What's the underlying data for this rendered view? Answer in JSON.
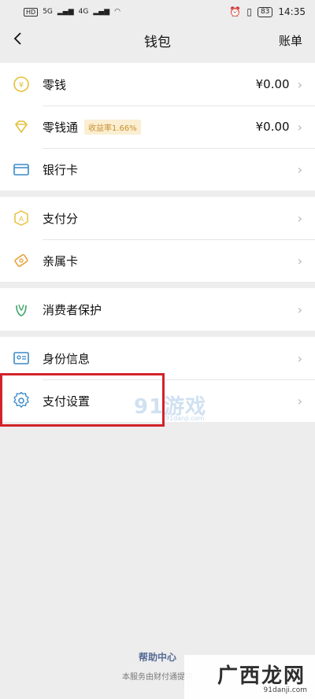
{
  "status": {
    "left_icons": [
      "HD",
      "5G",
      "4G"
    ],
    "battery": "83",
    "time": "14:35"
  },
  "nav": {
    "back_icon": "chevron-left-icon",
    "back_glyph": "<",
    "title": "钱包",
    "right": "账单"
  },
  "groups": [
    {
      "rows": [
        {
          "label": "零钱",
          "value": "¥0.00",
          "icon": "coin-icon",
          "color": "#e6c03a"
        },
        {
          "label": "零钱通",
          "badge": "收益率1.66%",
          "value": "¥0.00",
          "icon": "diamond-icon",
          "color": "#e6c03a"
        },
        {
          "label": "银行卡",
          "icon": "card-icon",
          "color": "#3a8ac9"
        }
      ]
    },
    {
      "rows": [
        {
          "label": "支付分",
          "icon": "score-icon",
          "color": "#e6c03a"
        },
        {
          "label": "亲属卡",
          "icon": "family-card-icon",
          "color": "#e6a23a"
        }
      ]
    },
    {
      "rows": [
        {
          "label": "消费者保护",
          "icon": "protect-icon",
          "color": "#3aa565"
        }
      ]
    },
    {
      "rows": [
        {
          "label": "身份信息",
          "icon": "id-icon",
          "color": "#3a8ac9"
        },
        {
          "label": "支付设置",
          "icon": "gear-icon",
          "color": "#3a8ac9"
        }
      ]
    }
  ],
  "chevron": "›",
  "footer": {
    "link": "帮助中心",
    "note": "本服务由财付通提供"
  },
  "watermarks": {
    "top": "91游戏",
    "top_url": "91danji.com",
    "bottom": "广西龙网",
    "bottom_url": "91danji.com"
  },
  "highlight_color": "#d2232a"
}
